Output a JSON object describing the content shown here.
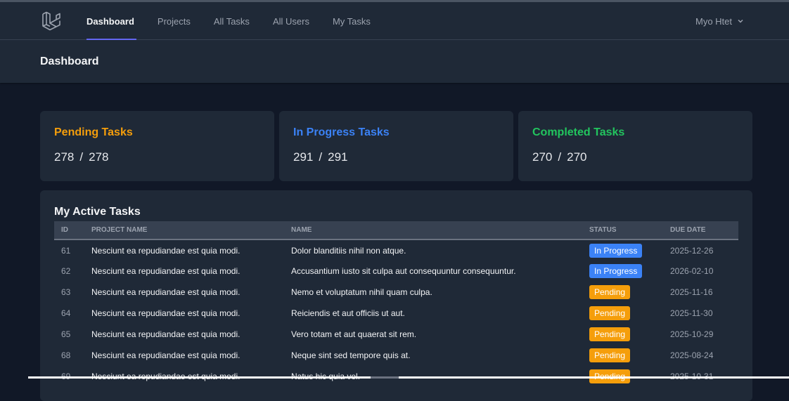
{
  "nav": {
    "links": [
      {
        "label": "Dashboard",
        "active": true
      },
      {
        "label": "Projects",
        "active": false
      },
      {
        "label": "All Tasks",
        "active": false
      },
      {
        "label": "All Users",
        "active": false
      },
      {
        "label": "My Tasks",
        "active": false
      }
    ],
    "user_name": "Myo Htet"
  },
  "header": {
    "title": "Dashboard"
  },
  "stats": {
    "pending": {
      "title": "Pending Tasks",
      "mine": "278",
      "total": "278",
      "color": "#f59e0b"
    },
    "in_progress": {
      "title": "In Progress Tasks",
      "mine": "291",
      "total": "291",
      "color": "#3b82f6"
    },
    "completed": {
      "title": "Completed Tasks",
      "mine": "270",
      "total": "270",
      "color": "#22c55e"
    },
    "separator": "/"
  },
  "active_tasks": {
    "title": "My Active Tasks",
    "columns": [
      "ID",
      "Project Name",
      "Name",
      "Status",
      "Due Date"
    ],
    "rows": [
      {
        "id": "61",
        "project": "Nesciunt ea repudiandae est quia modi.",
        "name": "Dolor blanditiis nihil non atque.",
        "status": "In Progress",
        "status_key": "in_progress",
        "due": "2025-12-26"
      },
      {
        "id": "62",
        "project": "Nesciunt ea repudiandae est quia modi.",
        "name": "Accusantium iusto sit culpa aut consequuntur consequuntur.",
        "status": "In Progress",
        "status_key": "in_progress",
        "due": "2026-02-10"
      },
      {
        "id": "63",
        "project": "Nesciunt ea repudiandae est quia modi.",
        "name": "Nemo et voluptatum nihil quam culpa.",
        "status": "Pending",
        "status_key": "pending",
        "due": "2025-11-16"
      },
      {
        "id": "64",
        "project": "Nesciunt ea repudiandae est quia modi.",
        "name": "Reiciendis et aut officiis ut aut.",
        "status": "Pending",
        "status_key": "pending",
        "due": "2025-11-30"
      },
      {
        "id": "65",
        "project": "Nesciunt ea repudiandae est quia modi.",
        "name": "Vero totam et aut quaerat sit rem.",
        "status": "Pending",
        "status_key": "pending",
        "due": "2025-10-29"
      },
      {
        "id": "68",
        "project": "Nesciunt ea repudiandae est quia modi.",
        "name": "Neque sint sed tempore quis at.",
        "status": "Pending",
        "status_key": "pending",
        "due": "2025-08-24"
      },
      {
        "id": "69",
        "project": "Nesciunt ea repudiandae est quia modi.",
        "name": "Natus hic quia vel.",
        "status": "Pending",
        "status_key": "pending",
        "due": "2025-10-31"
      }
    ]
  },
  "icons": {
    "logo": "laravel-logo-icon",
    "user_dropdown": "chevron-down-icon"
  }
}
